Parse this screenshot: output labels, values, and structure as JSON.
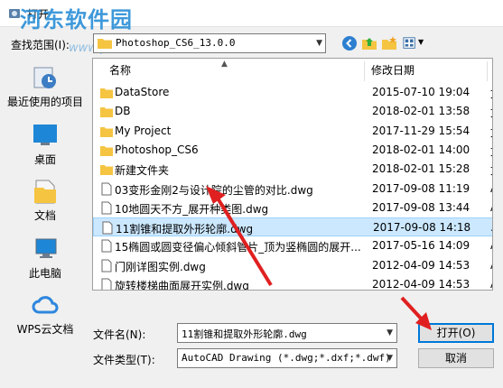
{
  "window": {
    "title": "打开"
  },
  "watermark": {
    "text": "河东软件园",
    "url": "www.pc0359.cn"
  },
  "lookin": {
    "label": "查找范围(I):",
    "value": "Photoshop_CS6_13.0.0"
  },
  "places": [
    {
      "label": "最近使用的项目",
      "icon": "recent-items-icon"
    },
    {
      "label": "桌面",
      "icon": "desktop-icon"
    },
    {
      "label": "文档",
      "icon": "documents-icon"
    },
    {
      "label": "此电脑",
      "icon": "this-pc-icon"
    },
    {
      "label": "WPS云文档",
      "icon": "wps-cloud-icon"
    }
  ],
  "columns": {
    "name": "名称",
    "date": "修改日期"
  },
  "files": [
    {
      "name": "DataStore",
      "date": "2015-07-10 19:04",
      "type": "folder",
      "ext": "文"
    },
    {
      "name": "DB",
      "date": "2018-02-01 13:58",
      "type": "folder",
      "ext": "文"
    },
    {
      "name": "My Project",
      "date": "2017-11-29 15:54",
      "type": "folder",
      "ext": "文"
    },
    {
      "name": "Photoshop_CS6",
      "date": "2018-02-01 14:00",
      "type": "folder",
      "ext": "文"
    },
    {
      "name": "新建文件夹",
      "date": "2018-02-01 15:28",
      "type": "folder",
      "ext": "文"
    },
    {
      "name": "03变形金刚2与设计院的尘管的对比.dwg",
      "date": "2017-09-08 11:19",
      "type": "file",
      "ext": "A"
    },
    {
      "name": "10地圆天不方_展开种类图.dwg",
      "date": "2017-09-08 13:44",
      "type": "file",
      "ext": "A"
    },
    {
      "name": "11割锥和提取外形轮廓.dwg",
      "date": "2017-09-08 14:18",
      "type": "file",
      "ext": "A",
      "selected": true
    },
    {
      "name": "15椭圆或圆变径偏心倾斜管片_顶为竖椭圆的展开...",
      "date": "2017-05-16 14:09",
      "type": "file",
      "ext": "A"
    },
    {
      "name": "门刚详图实例.dwg",
      "date": "2012-04-09 14:53",
      "type": "file",
      "ext": "A"
    },
    {
      "name": "旋转楼梯曲面展开实例.dwg",
      "date": "2012-04-09 14:53",
      "type": "file",
      "ext": "A"
    }
  ],
  "filename": {
    "label": "文件名(N):",
    "value": "11割锥和提取外形轮廓.dwg"
  },
  "filetype": {
    "label": "文件类型(T):",
    "value": "AutoCAD Drawing (*.dwg;*.dxf;*.dwf)"
  },
  "buttons": {
    "open": "打开(O)",
    "cancel": "取消"
  },
  "colors": {
    "selection": "#cce8ff",
    "accent": "#0078d7",
    "annotation_arrow": "#e02020",
    "folder": "#f5c441"
  }
}
